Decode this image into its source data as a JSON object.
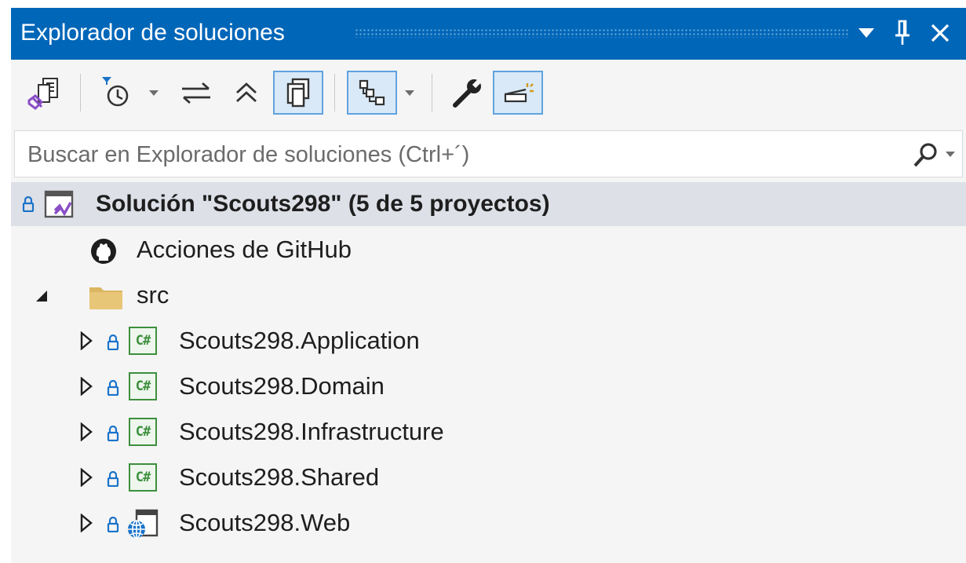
{
  "window": {
    "title": "Explorador de soluciones",
    "buttons": {
      "menu": "▼",
      "pin": "pin-icon",
      "close": "close-icon"
    }
  },
  "toolbar": {
    "tools": [
      {
        "name": "switch-views-icon"
      },
      {
        "name": "pending-changes-filter-icon",
        "dropdown": true
      },
      {
        "name": "sync-active-document-icon"
      },
      {
        "name": "collapse-all-icon"
      },
      {
        "name": "show-all-files-icon",
        "pressed": true
      },
      {
        "name": "class-view-icon",
        "pressed": true,
        "dropdown": true
      },
      {
        "name": "properties-wrench-icon"
      },
      {
        "name": "preview-selected-items-icon",
        "pressed": true
      }
    ]
  },
  "search": {
    "placeholder": "Buscar en Explorador de soluciones (Ctrl+´)",
    "value": ""
  },
  "tree": {
    "solution": {
      "label": "Solución \"Scouts298\"  (5 de 5 proyectos)"
    },
    "items": [
      {
        "label": "Acciones de GitHub",
        "icon": "github-icon"
      },
      {
        "label": "src",
        "icon": "folder-icon",
        "expanded": true
      },
      {
        "label": "Scouts298.Application",
        "icon": "csharp-project-icon"
      },
      {
        "label": "Scouts298.Domain",
        "icon": "csharp-project-icon"
      },
      {
        "label": "Scouts298.Infrastructure",
        "icon": "csharp-project-icon"
      },
      {
        "label": "Scouts298.Shared",
        "icon": "csharp-project-icon"
      },
      {
        "label": "Scouts298.Web",
        "icon": "web-project-icon"
      }
    ],
    "csharp_badge": "C#"
  },
  "colors": {
    "titlebar": "#0066b8",
    "selected_row": "#dde0e7",
    "lock": "#1a73c9",
    "csharp": "#3d8f3d",
    "folder": "#dcb560"
  }
}
